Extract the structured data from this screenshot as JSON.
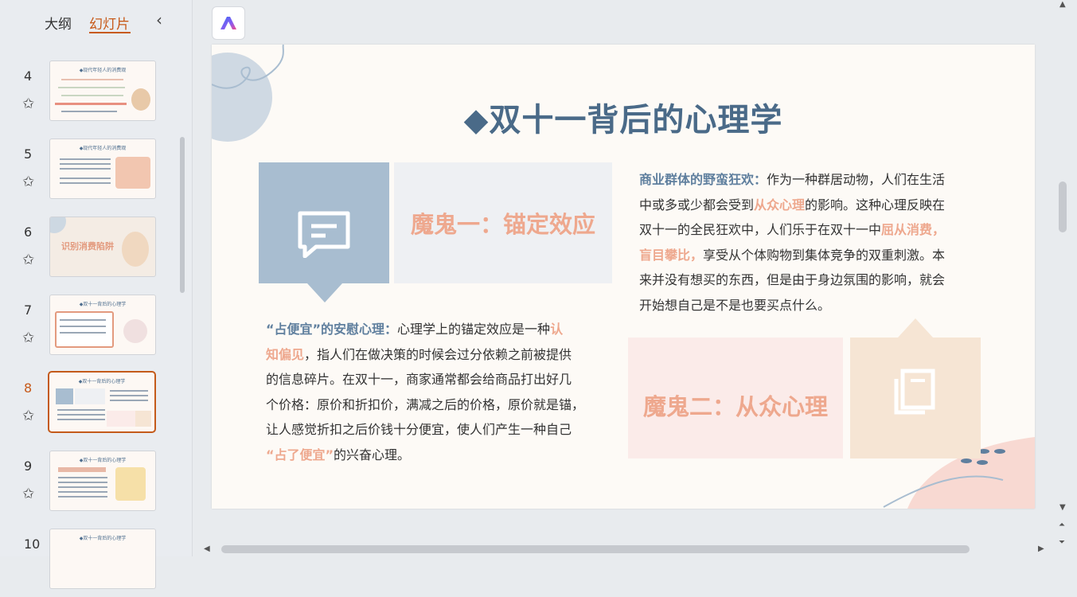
{
  "sidebar": {
    "tabs": [
      "大纲",
      "幻灯片"
    ],
    "active_tab": "幻灯片",
    "collapse_icon": "chevron-left-icon",
    "thumbnails": [
      {
        "num": "4",
        "title": "◆现代年轻人的消费观"
      },
      {
        "num": "5",
        "title": "◆现代年轻人的消费观"
      },
      {
        "num": "6",
        "title": "识别消费陷阱"
      },
      {
        "num": "7",
        "title": "◆双十一背后的心理学"
      },
      {
        "num": "8",
        "title": "◆双十一背后的心理学",
        "active": true
      },
      {
        "num": "9",
        "title": "◆双十一背后的心理学"
      },
      {
        "num": "10",
        "title": "◆双十一背后的心理学"
      }
    ]
  },
  "slide": {
    "title": "◆双十一背后的心理学",
    "left_panel_title": "魔鬼一：锚定效应",
    "right_panel_title": "魔鬼二：从众心理",
    "left_para": {
      "p1": "“占便宜”的安慰心理：",
      "p2": "心理学上的锚定效应是一种",
      "p3": "认",
      "p4": "知偏见",
      "p5": "，指人们在做决策的时候会过分依赖之前被提供",
      "p6": "的信息碎片。在双十一，商家通常都会给商品打出好几",
      "p7": "个价格：原价和折扣价，满减之后的价格，原价就是锚，",
      "p8": "让人感觉折扣之后价钱十分便宜，使人们产生一种自己",
      "p9": "“占了便宜”",
      "p10": "的兴奋心理。"
    },
    "right_para": {
      "p1": "商业群体的野蛮狂欢：",
      "p2": "作为一种群居动物，人们在生活",
      "p3": "中或多或少都会受到",
      "p4": "从众心理",
      "p5": "的影响。这种心理反映在",
      "p6": "双十一的全民狂欢中，人们乐于在双十一中",
      "p7": "屈从消费，",
      "p8": "盲目攀比，",
      "p9": "享受从个体购物到集体竞争的双重刺激。本",
      "p10": "来并没有想买的东西，但是由于身边氛围的影响，就会",
      "p11": "开始想自己是不是也要买点什么。"
    }
  },
  "colors": {
    "accent": "#c75a1a",
    "title_blue": "#4a6a88",
    "peach": "#eea88e",
    "blue_square": "#a8bdd0"
  }
}
